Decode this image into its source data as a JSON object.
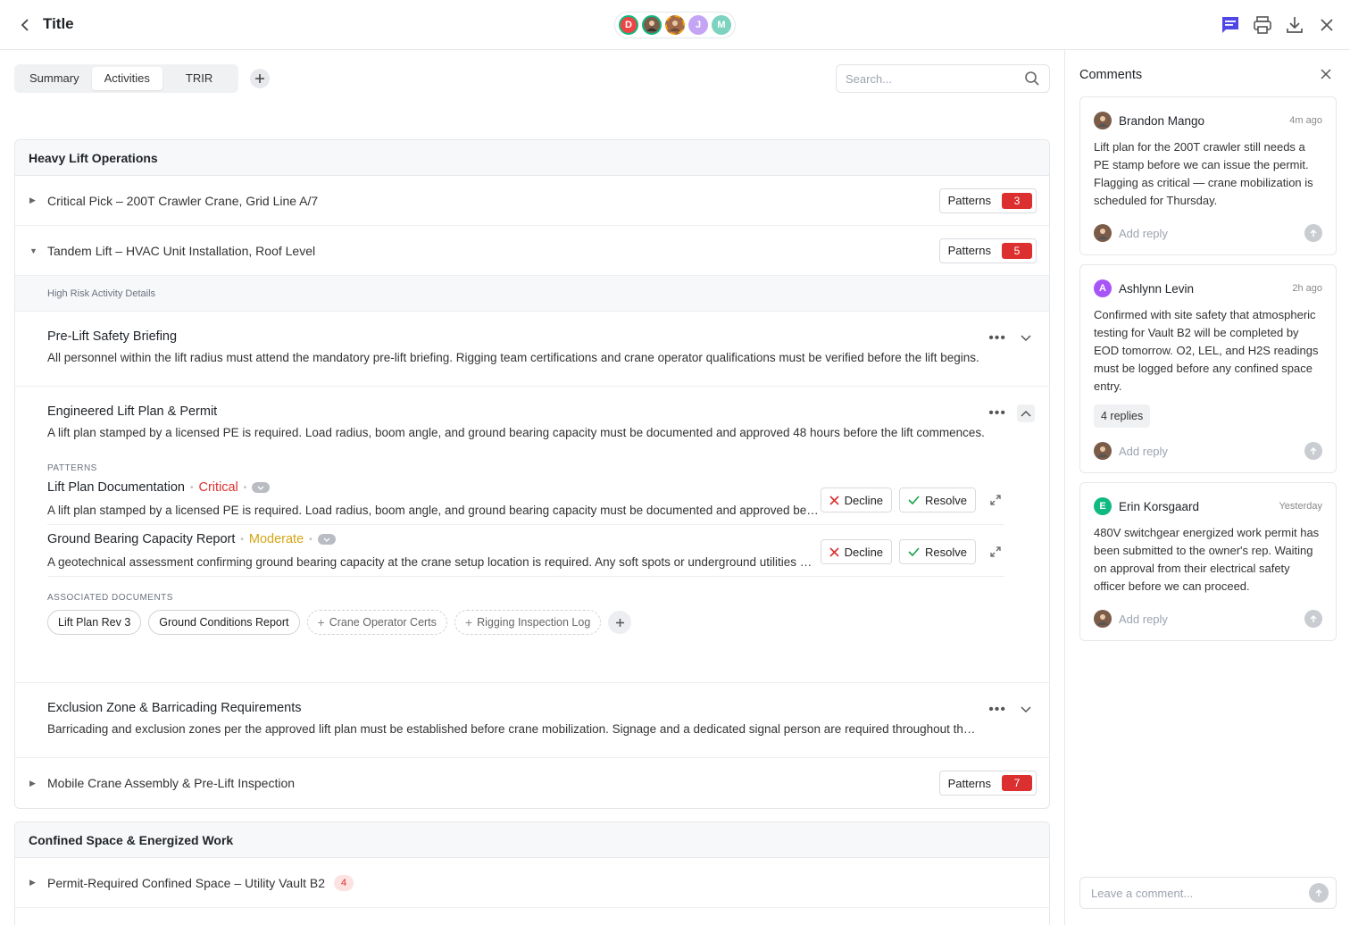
{
  "header": {
    "title": "Title",
    "avatars": [
      "D",
      "",
      "",
      "J",
      "M"
    ]
  },
  "tabs": [
    {
      "label": "Summary"
    },
    {
      "label": "Activities"
    },
    {
      "label": "TRIR"
    }
  ],
  "search": {
    "placeholder": "Search..."
  },
  "sections": [
    {
      "title": "Heavy Lift Operations",
      "rows": [
        {
          "title": "Critical Pick – 200T Crawler Crane, Grid Line A/7",
          "patterns_label": "Patterns",
          "count": "3"
        },
        {
          "title": "Tandem Lift – HVAC Unit Installation, Roof Level",
          "patterns_label": "Patterns",
          "count": "5"
        }
      ],
      "details_label": "High Risk Activity Details",
      "items": [
        {
          "title": "Pre-Lift Safety Briefing",
          "desc": "All personnel within the lift radius must attend the mandatory pre-lift briefing. Rigging team certifications and crane operator qualifications must be verified before the lift begins."
        },
        {
          "title": "Engineered Lift Plan & Permit",
          "desc": "A lift plan stamped by a licensed PE is required. Load radius, boom angle, and ground bearing capacity must be documented and approved 48 hours before the lift commences.",
          "patterns_label": "PATTERNS",
          "patterns": [
            {
              "name": "Lift Plan Documentation",
              "severity": "Critical",
              "desc": "A lift plan stamped by a licensed PE is required. Load radius, boom angle, and ground bearing capacity must be documented and approved before mobilization.",
              "decline": "Decline",
              "resolve": "Resolve"
            },
            {
              "name": "Ground Bearing Capacity Report",
              "severity": "Moderate",
              "desc": "A geotechnical assessment confirming ground bearing capacity at the crane setup location is required. Any soft spots or underground utilities must be identified.",
              "decline": "Decline",
              "resolve": "Resolve"
            }
          ],
          "docs_label": "ASSOCIATED DOCUMENTS",
          "docs": [
            "Lift Plan Rev 3",
            "Ground Conditions Report"
          ],
          "docs_missing": [
            "Crane Operator Certs",
            "Rigging Inspection Log"
          ]
        },
        {
          "title": "Exclusion Zone & Barricading Requirements",
          "desc": "Barricading and exclusion zones per the approved lift plan must be established before crane mobilization. Signage and a dedicated signal person are required throughout the lift."
        }
      ],
      "last_row": {
        "title": "Mobile Crane Assembly & Pre-Lift Inspection",
        "patterns_label": "Patterns",
        "count": "7"
      }
    },
    {
      "title": "Confined Space & Energized Work",
      "rows": [
        {
          "title": "Permit-Required Confined Space – Utility Vault B2",
          "count": "4"
        }
      ]
    }
  ],
  "comments": {
    "title": "Comments",
    "reply_placeholder": "Add reply",
    "leave_placeholder": "Leave a comment...",
    "items": [
      {
        "name": "Brandon Mango",
        "time": "4m ago",
        "body": "Lift plan for the 200T crawler still needs a PE stamp before we can issue the permit. Flagging as critical — crane mobilization is scheduled for Thursday."
      },
      {
        "initial": "A",
        "name": "Ashlynn Levin",
        "time": "2h ago",
        "body": "Confirmed with site safety that atmospheric testing for Vault B2 will be completed by EOD tomorrow. O2, LEL, and H2S readings must be logged before any confined space entry.",
        "replies": "4 replies"
      },
      {
        "initial": "E",
        "name": "Erin Korsgaard",
        "time": "Yesterday",
        "body": "480V switchgear energized work permit has been submitted to the owner's rep. Waiting on approval from their electrical safety officer before we can proceed."
      }
    ]
  },
  "colors": {
    "accent": "#4f46e5",
    "critical": "#dc2f2f",
    "moderate": "#d4a516",
    "resolve_check": "#16a34a"
  }
}
